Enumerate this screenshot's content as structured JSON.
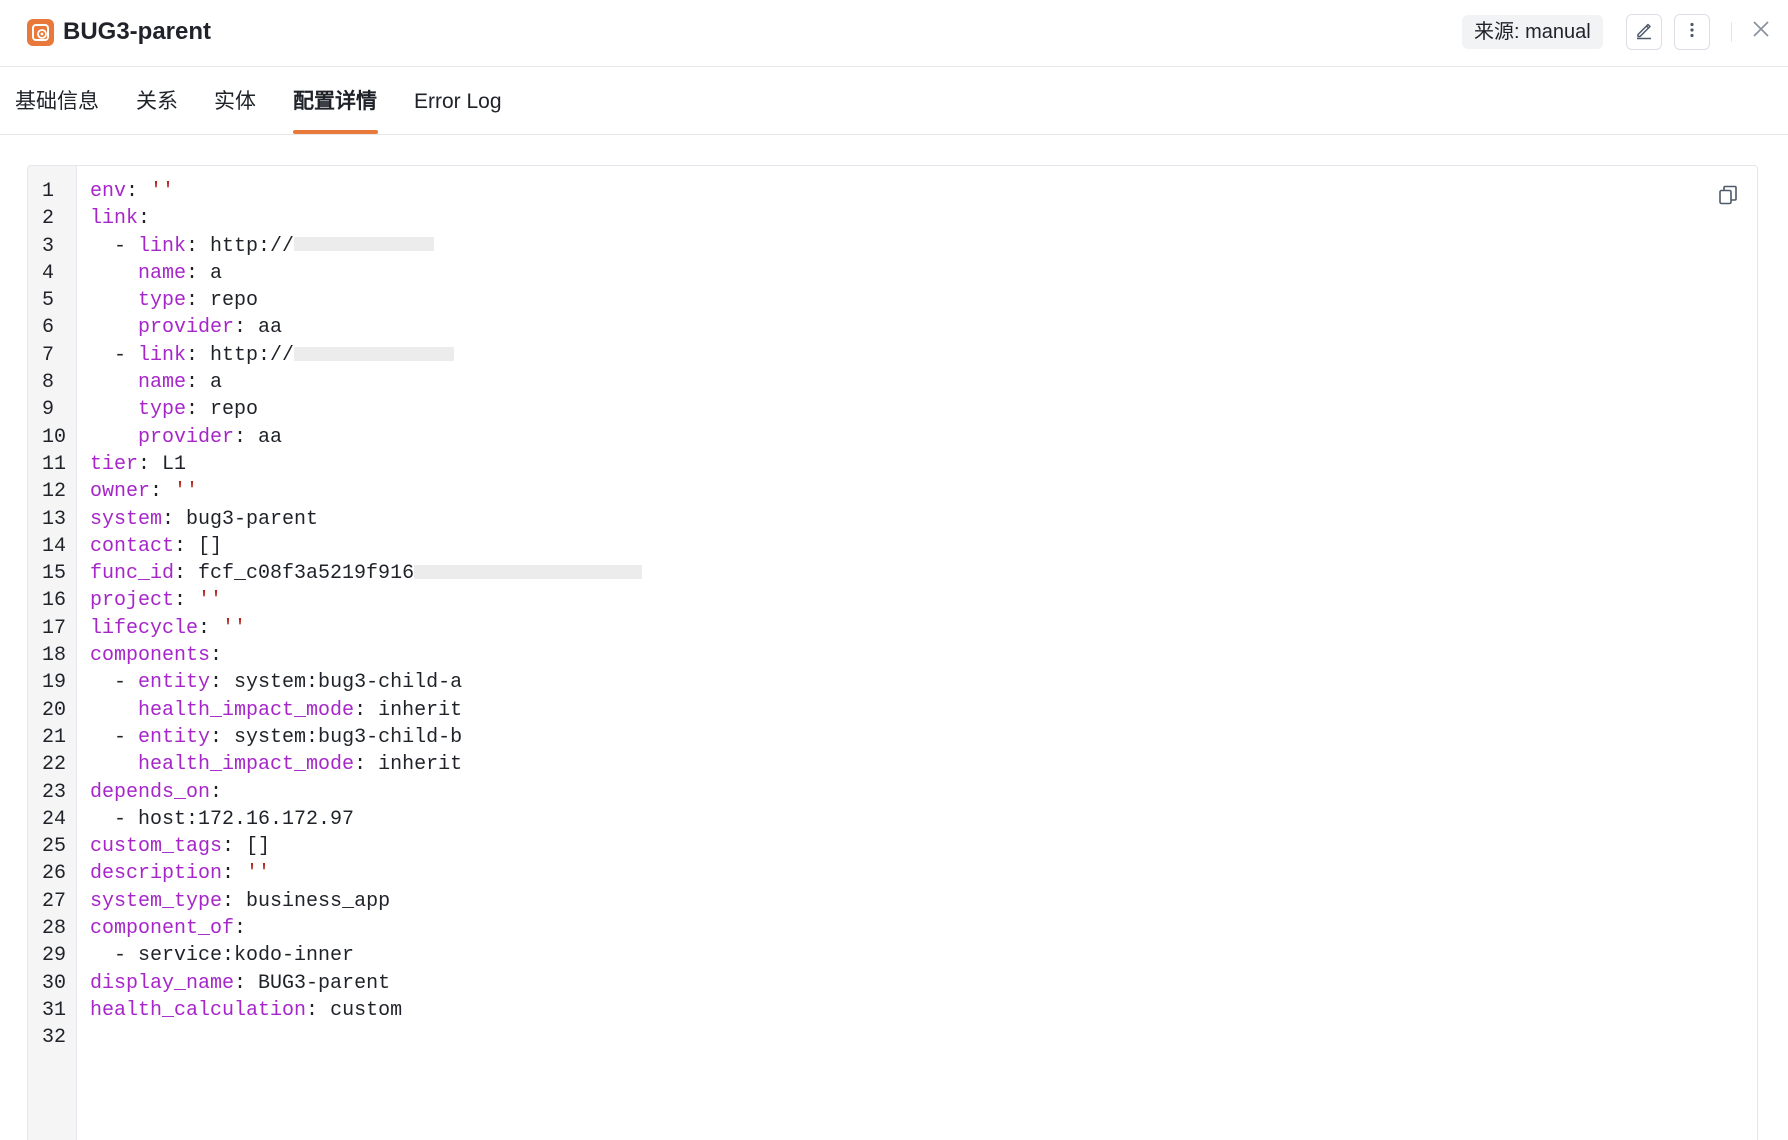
{
  "header": {
    "title": "BUG3-parent",
    "source_label": "来源: manual",
    "accent_color": "#e8793a"
  },
  "tabs": [
    {
      "label": "基础信息",
      "active": false
    },
    {
      "label": "关系",
      "active": false
    },
    {
      "label": "实体",
      "active": false
    },
    {
      "label": "配置详情",
      "active": true
    },
    {
      "label": "Error Log",
      "active": false
    }
  ],
  "editor": {
    "lines": [
      {
        "n": "1",
        "indent": "",
        "dash": "",
        "key": "env",
        "sep": ": ",
        "value": "''",
        "value_type": "string"
      },
      {
        "n": "2",
        "indent": "",
        "dash": "",
        "key": "link",
        "sep": ":",
        "value": "",
        "value_type": "plain"
      },
      {
        "n": "3",
        "indent": "  ",
        "dash": "- ",
        "key": "link",
        "sep": ": ",
        "value": "http://",
        "value_type": "plain",
        "redacted": true,
        "redact_width": 140
      },
      {
        "n": "4",
        "indent": "    ",
        "dash": "",
        "key": "name",
        "sep": ": ",
        "value": "a",
        "value_type": "plain"
      },
      {
        "n": "5",
        "indent": "    ",
        "dash": "",
        "key": "type",
        "sep": ": ",
        "value": "repo",
        "value_type": "plain"
      },
      {
        "n": "6",
        "indent": "    ",
        "dash": "",
        "key": "provider",
        "sep": ": ",
        "value": "aa",
        "value_type": "plain"
      },
      {
        "n": "7",
        "indent": "  ",
        "dash": "- ",
        "key": "link",
        "sep": ": ",
        "value": "http://",
        "value_type": "plain",
        "redacted": true,
        "redact_width": 160
      },
      {
        "n": "8",
        "indent": "    ",
        "dash": "",
        "key": "name",
        "sep": ": ",
        "value": "a",
        "value_type": "plain"
      },
      {
        "n": "9",
        "indent": "    ",
        "dash": "",
        "key": "type",
        "sep": ": ",
        "value": "repo",
        "value_type": "plain"
      },
      {
        "n": "10",
        "indent": "    ",
        "dash": "",
        "key": "provider",
        "sep": ": ",
        "value": "aa",
        "value_type": "plain"
      },
      {
        "n": "11",
        "indent": "",
        "dash": "",
        "key": "tier",
        "sep": ": ",
        "value": "L1",
        "value_type": "plain"
      },
      {
        "n": "12",
        "indent": "",
        "dash": "",
        "key": "owner",
        "sep": ": ",
        "value": "''",
        "value_type": "string"
      },
      {
        "n": "13",
        "indent": "",
        "dash": "",
        "key": "system",
        "sep": ": ",
        "value": "bug3-parent",
        "value_type": "plain"
      },
      {
        "n": "14",
        "indent": "",
        "dash": "",
        "key": "contact",
        "sep": ": ",
        "value": "[]",
        "value_type": "plain"
      },
      {
        "n": "15",
        "indent": "",
        "dash": "",
        "key": "func_id",
        "sep": ": ",
        "value": "fcf_c08f3a5219f916",
        "value_type": "plain",
        "redacted": true,
        "redact_width": 228
      },
      {
        "n": "16",
        "indent": "",
        "dash": "",
        "key": "project",
        "sep": ": ",
        "value": "''",
        "value_type": "string"
      },
      {
        "n": "17",
        "indent": "",
        "dash": "",
        "key": "lifecycle",
        "sep": ": ",
        "value": "''",
        "value_type": "string"
      },
      {
        "n": "18",
        "indent": "",
        "dash": "",
        "key": "components",
        "sep": ":",
        "value": "",
        "value_type": "plain"
      },
      {
        "n": "19",
        "indent": "  ",
        "dash": "- ",
        "key": "entity",
        "sep": ": ",
        "value": "system:bug3-child-a",
        "value_type": "plain"
      },
      {
        "n": "20",
        "indent": "    ",
        "dash": "",
        "key": "health_impact_mode",
        "sep": ": ",
        "value": "inherit",
        "value_type": "plain"
      },
      {
        "n": "21",
        "indent": "  ",
        "dash": "- ",
        "key": "entity",
        "sep": ": ",
        "value": "system:bug3-child-b",
        "value_type": "plain"
      },
      {
        "n": "22",
        "indent": "    ",
        "dash": "",
        "key": "health_impact_mode",
        "sep": ": ",
        "value": "inherit",
        "value_type": "plain"
      },
      {
        "n": "23",
        "indent": "",
        "dash": "",
        "key": "depends_on",
        "sep": ":",
        "value": "",
        "value_type": "plain"
      },
      {
        "n": "24",
        "indent": "  ",
        "dash": "- ",
        "key": "",
        "sep": "",
        "value": "host:172.16.172.97",
        "value_type": "plain"
      },
      {
        "n": "25",
        "indent": "",
        "dash": "",
        "key": "custom_tags",
        "sep": ": ",
        "value": "[]",
        "value_type": "plain"
      },
      {
        "n": "26",
        "indent": "",
        "dash": "",
        "key": "description",
        "sep": ": ",
        "value": "''",
        "value_type": "string"
      },
      {
        "n": "27",
        "indent": "",
        "dash": "",
        "key": "system_type",
        "sep": ": ",
        "value": "business_app",
        "value_type": "plain"
      },
      {
        "n": "28",
        "indent": "",
        "dash": "",
        "key": "component_of",
        "sep": ":",
        "value": "",
        "value_type": "plain"
      },
      {
        "n": "29",
        "indent": "  ",
        "dash": "- ",
        "key": "",
        "sep": "",
        "value": "service:kodo-inner",
        "value_type": "plain"
      },
      {
        "n": "30",
        "indent": "",
        "dash": "",
        "key": "display_name",
        "sep": ": ",
        "value": "BUG3-parent",
        "value_type": "plain"
      },
      {
        "n": "31",
        "indent": "",
        "dash": "",
        "key": "health_calculation",
        "sep": ": ",
        "value": "custom",
        "value_type": "plain"
      },
      {
        "n": "32",
        "indent": "",
        "dash": "",
        "key": "",
        "sep": "",
        "value": "",
        "value_type": "plain"
      }
    ],
    "key_color": "#a626c9",
    "string_color": "#b3261e"
  },
  "icons": {
    "app": "entity-app-icon",
    "edit": "pencil-icon",
    "more": "more-vertical-icon",
    "close": "close-icon",
    "copy": "copy-icon"
  }
}
